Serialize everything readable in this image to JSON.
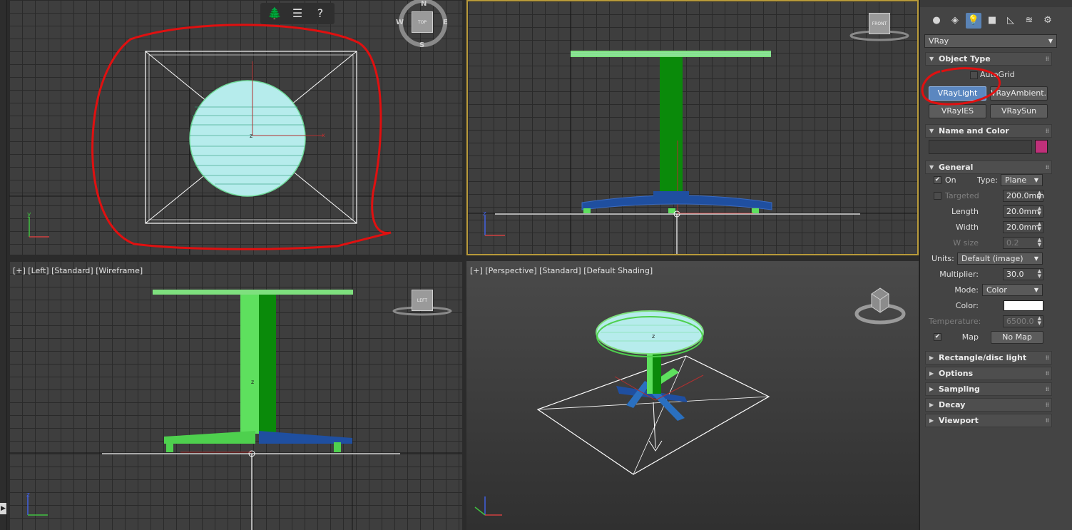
{
  "viewports": {
    "left": {
      "label": "[+] [Left] [Standard] [Wireframe]",
      "cube": "LEFT"
    },
    "perspective": {
      "label": "[+] [Perspective] [Standard] [Default Shading]"
    },
    "top": {
      "cube": "TOP",
      "compass": {
        "n": "N",
        "w": "W",
        "e": "E",
        "s": "S"
      }
    },
    "front": {
      "cube": "FRONT"
    }
  },
  "axis": {
    "x": "x",
    "y": "y",
    "z": "z"
  },
  "panel": {
    "renderer": "VRay",
    "object_type": {
      "title": "Object Type",
      "autogrid": "AutoGrid",
      "buttons": [
        "VRayLight",
        "VRayAmbient...",
        "VRayIES",
        "VRaySun"
      ]
    },
    "name_color": {
      "title": "Name and Color",
      "name_value": "",
      "color": "#c0307a"
    },
    "general": {
      "title": "General",
      "on_label": "On",
      "type_label": "Type:",
      "type_value": "Plane",
      "targeted_label": "Targeted",
      "targeted_value": "200.0mm",
      "length_label": "Length",
      "length_value": "20.0mm",
      "width_label": "Width",
      "width_value": "20.0mm",
      "wsize_label": "W size",
      "wsize_value": "0.2",
      "units_label": "Units:",
      "units_value": "Default (image)",
      "multiplier_label": "Multiplier:",
      "multiplier_value": "30.0",
      "mode_label": "Mode:",
      "mode_value": "Color",
      "color_label": "Color:",
      "color_value": "#ffffff",
      "temperature_label": "Temperature:",
      "temperature_value": "6500.0",
      "map_label": "Map",
      "map_button": "No Map"
    },
    "rollouts": [
      "Rectangle/disc light",
      "Options",
      "Sampling",
      "Decay",
      "Viewport"
    ]
  },
  "colors": {
    "selected_viewport_border": "#b89a3a",
    "annotation": "#e01010",
    "active_button": "#5b87c0",
    "wire": "#ffffff",
    "green_object": "#7ee07e",
    "blue_object": "#1f4fa0"
  }
}
